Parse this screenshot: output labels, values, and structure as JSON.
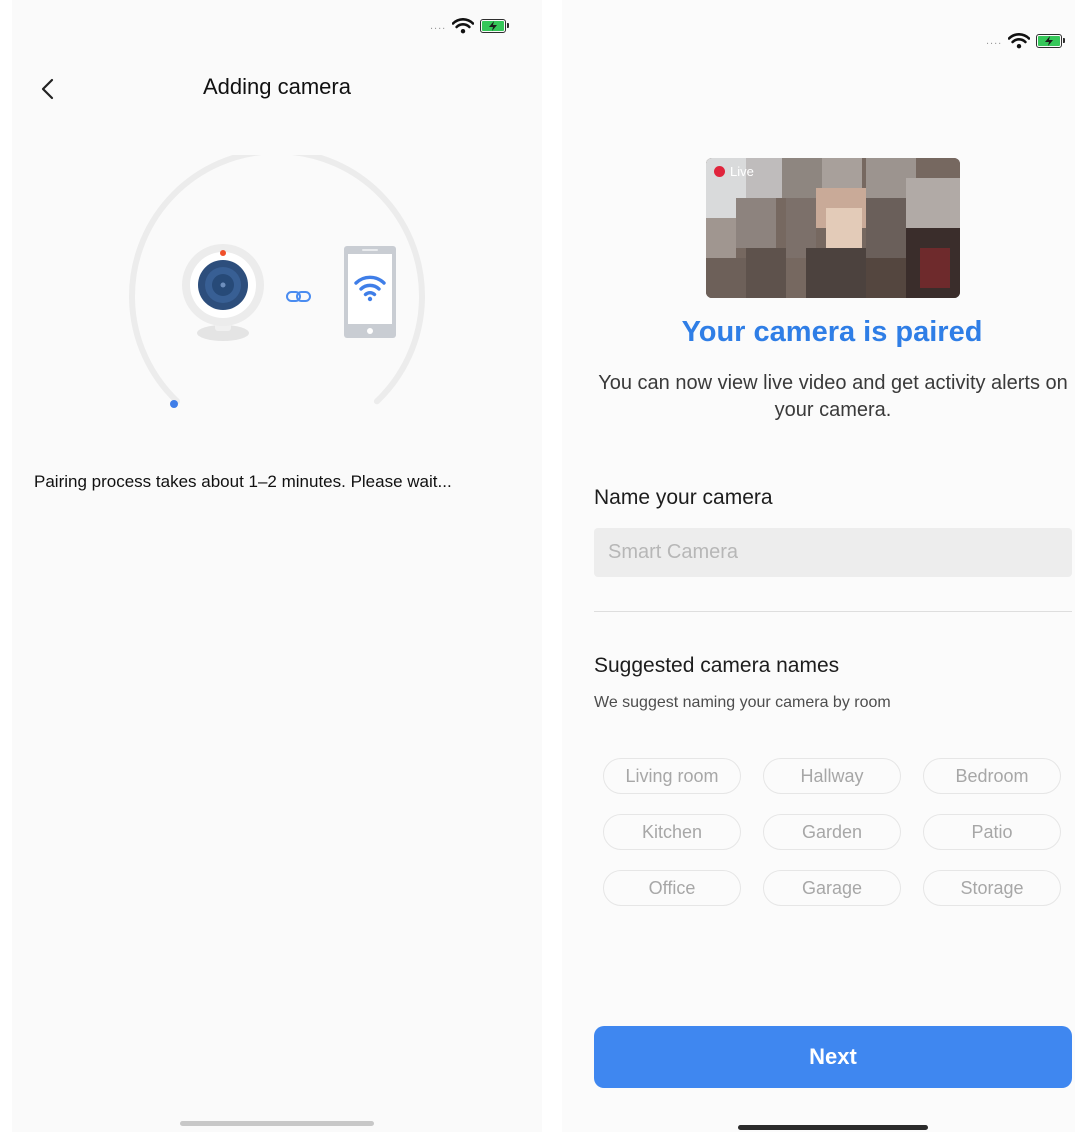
{
  "left_screen": {
    "status_bar": {
      "signal": "....",
      "wifi_icon": "wifi-icon",
      "battery_icon": "battery-charging-icon"
    },
    "nav": {
      "back_icon": "chevron-left-icon",
      "title": "Adding camera"
    },
    "illustration": {
      "camera_icon": "webcam-icon",
      "link_icon": "link-icon",
      "phone_icon": "phone-wifi-icon"
    },
    "message": "Pairing process takes about 1–2 minutes. Please wait..."
  },
  "right_screen": {
    "status_bar": {
      "signal": "....",
      "wifi_icon": "wifi-icon",
      "battery_icon": "battery-charging-icon"
    },
    "preview": {
      "live_label": "Live"
    },
    "title": "Your camera is paired",
    "description": "You can now view live video and get activity alerts on your camera.",
    "name_section": {
      "label": "Name your camera",
      "placeholder": "Smart Camera",
      "value": ""
    },
    "suggestions": {
      "title": "Suggested camera names",
      "subtitle": "We suggest naming your camera by room",
      "names": [
        "Living room",
        "Hallway",
        "Bedroom",
        "Kitchen",
        "Garden",
        "Patio",
        "Office",
        "Garage",
        "Storage"
      ]
    },
    "next_label": "Next"
  },
  "colors": {
    "accent_blue": "#2f7ee6",
    "button_blue": "#3f87f0",
    "progress_blue": "#3f7ee8",
    "battery_green": "#35c759",
    "record_red": "#e0243c"
  }
}
